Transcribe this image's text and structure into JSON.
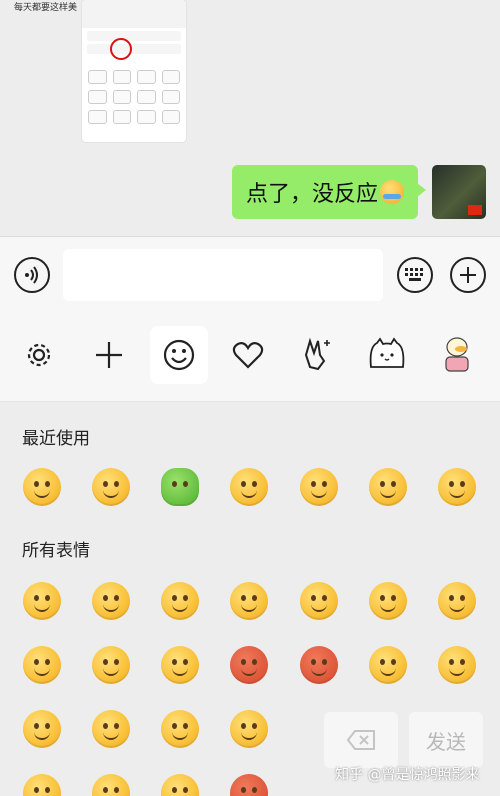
{
  "chat": {
    "top_caption": "每天都要这样美",
    "message_text": "点了，没反应"
  },
  "input": {
    "placeholder": ""
  },
  "tabs": [
    {
      "id": "settings",
      "icon": "gear-icon"
    },
    {
      "id": "add",
      "icon": "plus-icon"
    },
    {
      "id": "emoji",
      "icon": "smiley-icon",
      "active": true
    },
    {
      "id": "favorites",
      "icon": "heart-icon"
    },
    {
      "id": "gestures",
      "icon": "victory-hand-icon"
    },
    {
      "id": "cat-sticker",
      "icon": "cat-sticker-icon"
    },
    {
      "id": "duck-sticker",
      "icon": "duck-sticker-icon"
    }
  ],
  "sections": {
    "recent": "最近使用",
    "all": "所有表情"
  },
  "actions": {
    "delete_icon": "backspace-icon",
    "send_label": "发送"
  },
  "watermark": "知乎 @曾是惊鸿照影来",
  "colors": {
    "bubble": "#95ec69",
    "background": "#ededed",
    "emoji_yellow": "#f9c13a"
  }
}
